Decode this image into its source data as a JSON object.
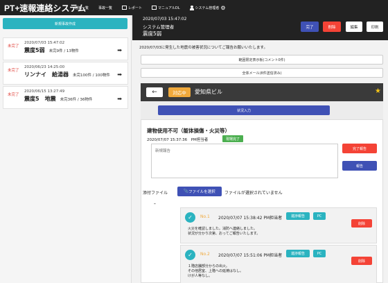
{
  "app": {
    "title": "PT+速報連絡システム",
    "nav": [
      {
        "label": "通知一覧"
      },
      {
        "label": "事故一覧"
      },
      {
        "label": "レポート"
      },
      {
        "label": "マニュアルDL"
      },
      {
        "label": "システム管理者"
      }
    ]
  },
  "sidebar": {
    "create_label": "新規事故作成",
    "incidents": [
      {
        "status": "未完了",
        "date": "2020/07/03 15:47:02",
        "title": "震度5弱",
        "counts": "未完9件 / 13物件"
      },
      {
        "status": "未完了",
        "date": "2020/06/23 14:25:00",
        "title": "リンナイ　給湯器",
        "counts": "未完100件 / 100物件"
      },
      {
        "status": "未完了",
        "date": "2020/06/15 13:27:49",
        "title": "震度5　地震",
        "counts": "未完36件 / 36物件"
      }
    ]
  },
  "header": {
    "date": "2020/07/03 15:47:02",
    "user": "システム管理者",
    "name": "震度5弱",
    "complete_label": "完了",
    "delete_label": "削除",
    "edit_label": "編集",
    "print_label": "印刷"
  },
  "notice": "2020/07/03に発生した地震の被害状況についてご報告お願いいたします。",
  "buttons": {
    "restricted_display": "範囲限定表示板(コメント0件)",
    "all_mail": "全体メール(8件送信済み)"
  },
  "detail": {
    "status_badge": "対応中",
    "building": "愛知県ビル",
    "status_input_label": "状況入力",
    "card": {
      "title": "建物使用不可（躯体損傷・火災等）",
      "date": "2020/07/07 15:37:36　PM担当者",
      "badge": "現場完了",
      "textarea_placeholder": "新規報告",
      "report_done_label": "完了報告",
      "report_label": "報告",
      "attach_label": "添付ファイル",
      "file_button_label": "ファイルを選択",
      "file_status": "ファイルが選択されていません",
      "dash": "-"
    },
    "reports": [
      {
        "no": "No.1",
        "time": "2020/07/07 15:38:42 PM担当者",
        "tag_progress": "進捗報告",
        "tag_pc": "PC",
        "lines": [
          "火災を確認しました。消防へ連絡しました。",
          "状況が分かり次第、おってご報告いたします。"
        ],
        "delete_label": "削除"
      },
      {
        "no": "No.2",
        "time": "2020/07/07 15:51:06 PM担当者",
        "tag_progress": "進捗報告",
        "tag_pc": "PC",
        "lines": [
          "１階店舗部分からの出火。",
          "その他居室、上階への延焼はなし。",
          "けが人等なし。"
        ],
        "delete_label": "削除"
      }
    ]
  }
}
